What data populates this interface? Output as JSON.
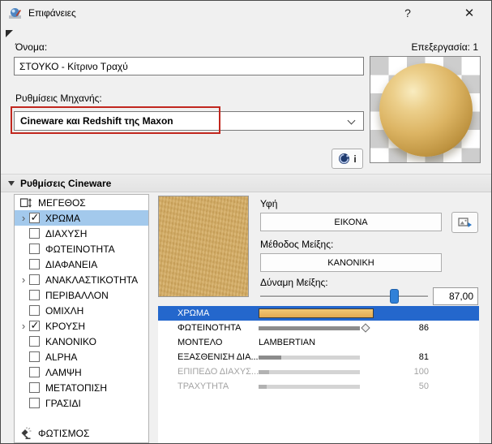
{
  "window": {
    "title": "Επιφάνειες",
    "help": "?",
    "close": "✕"
  },
  "header": {
    "name_label": "Όνομα:",
    "edited_label": "Επεξεργασία: 1",
    "name_value": "ΣΤΟΥΚΟ - Κίτρινο Τραχύ",
    "engine_label": "Ρυθμίσεις Μηχανής:",
    "engine_value": "Cineware και Redshift της Maxon",
    "info_button": "i"
  },
  "section_header": {
    "label": "Ρυθμίσεις Cineware"
  },
  "channels": [
    {
      "label": "ΜΕΓΕΘΟΣ",
      "kind": "size-icon"
    },
    {
      "label": "ΧΡΩΜΑ",
      "kind": "checkbox",
      "checked": true,
      "expandable": true,
      "selected": true
    },
    {
      "label": "ΔΙΑΧΥΣΗ",
      "kind": "checkbox",
      "checked": false
    },
    {
      "label": "ΦΩΤΕΙΝΟΤΗΤΑ",
      "kind": "checkbox",
      "checked": false
    },
    {
      "label": "ΔΙΑΦΑΝΕΙΑ",
      "kind": "checkbox",
      "checked": false
    },
    {
      "label": "ΑΝΑΚΛΑΣΤΙΚΟΤΗΤΑ",
      "kind": "checkbox",
      "checked": false,
      "expandable": true
    },
    {
      "label": "ΠΕΡΙΒΑΛΛΟΝ",
      "kind": "checkbox",
      "checked": false
    },
    {
      "label": "ΟΜΙΧΛΗ",
      "kind": "checkbox",
      "checked": false
    },
    {
      "label": "ΚΡΟΥΣΗ",
      "kind": "checkbox",
      "checked": true,
      "expandable": true
    },
    {
      "label": "ΚΑΝΟΝΙΚΟ",
      "kind": "checkbox",
      "checked": false
    },
    {
      "label": "ALPHA",
      "kind": "checkbox",
      "checked": false
    },
    {
      "label": "ΛΑΜΨΗ",
      "kind": "checkbox",
      "checked": false
    },
    {
      "label": "ΜΕΤΑΤΟΠΙΣΗ",
      "kind": "checkbox",
      "checked": false
    },
    {
      "label": "ΓΡΑΣΙΔΙ",
      "kind": "checkbox",
      "checked": false
    },
    {
      "label": "ΦΩΤΙΣΜΟΣ",
      "kind": "light-icon",
      "pinned_bottom": true
    }
  ],
  "texture_panel": {
    "texture_label": "Υφή",
    "image_button": "ΕΙΚΟΝΑ",
    "mix_method_label": "Μέθοδος Μείξης:",
    "mix_method_value": "ΚΑΝΟΝΙΚΗ",
    "mix_strength_label": "Δύναμη Μείξης:",
    "mix_strength_value": "87,00",
    "mix_strength_percent": 80
  },
  "properties": [
    {
      "label": "ΧΡΩΜΑ",
      "type": "color",
      "selected": true,
      "swatch_from": "#f2c775",
      "swatch_to": "#e3aa52"
    },
    {
      "label": "ΦΩΤΕΙΝΟΤΗΤΑ",
      "type": "slider",
      "value": "86",
      "fill": 100,
      "marker": true
    },
    {
      "label": "ΜΟΝΤΕΛΟ",
      "type": "text",
      "value": "LAMBERTIAN"
    },
    {
      "label": "ΕΞΑΣΘΕΝΙΣΗ ΔΙΑ...",
      "type": "slider",
      "value": "81",
      "fill": 22
    },
    {
      "label": "ΕΠΙΠΕΔΟ ΔΙΑΧΥΣ...",
      "type": "slider",
      "value": "100",
      "fill": 10,
      "disabled": true
    },
    {
      "label": "ΤΡΑΧΥΤΗΤΑ",
      "type": "slider",
      "value": "50",
      "fill": 8,
      "disabled": true
    }
  ],
  "colors": {
    "annotation_red": "#c1271e",
    "selection_blue": "#2467cc",
    "list_selection_blue": "#a3c9ec",
    "sphere_gold": "#dcb463",
    "texture_tan": "#d5ac63"
  }
}
